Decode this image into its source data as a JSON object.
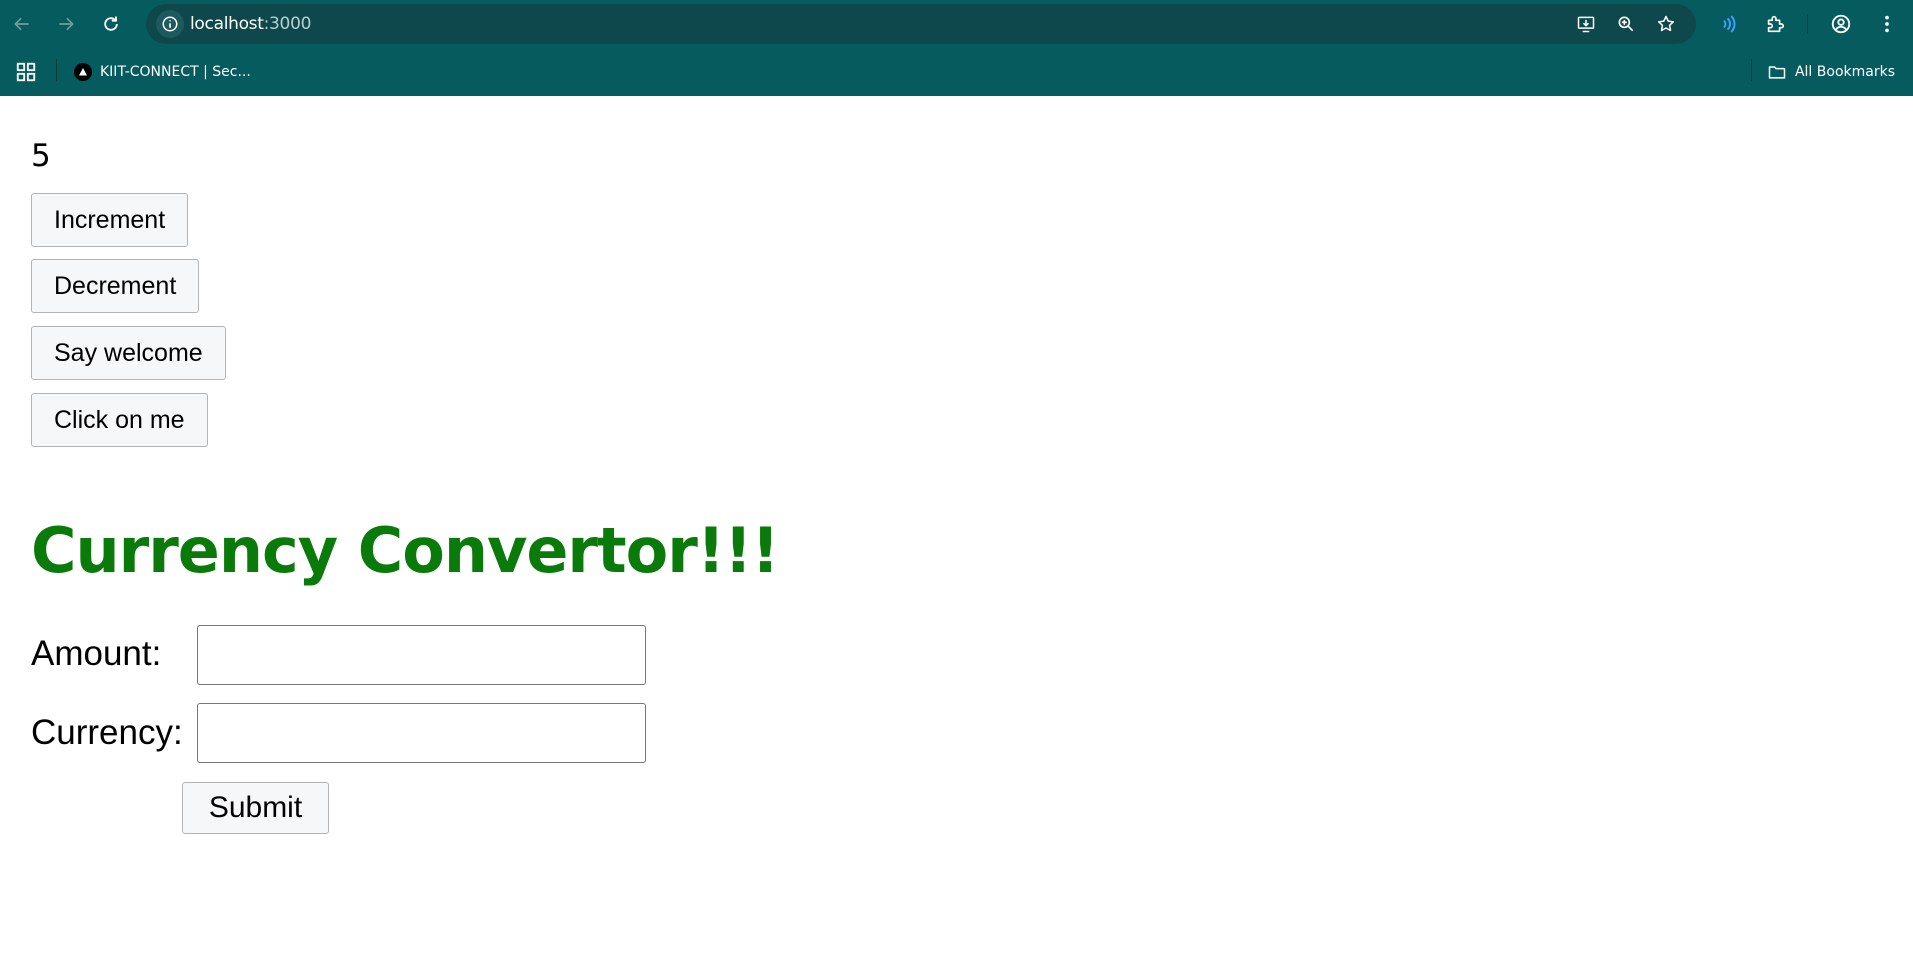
{
  "browser": {
    "url_host": "localhost",
    "url_port": ":3000",
    "bookmarks": [
      {
        "label": "KIIT-CONNECT | Sec..."
      }
    ],
    "all_bookmarks_label": "All Bookmarks",
    "toolbar_icons": [
      "back-icon",
      "forward-icon",
      "reload-icon",
      "site-info-icon",
      "install-app-icon",
      "zoom-icon",
      "bookmark-star-icon",
      "extension-active-icon",
      "extensions-icon",
      "profile-icon",
      "menu-icon"
    ]
  },
  "page": {
    "counter_value": "5",
    "buttons": {
      "increment": "Increment",
      "decrement": "Decrement",
      "say_welcome": "Say welcome",
      "click_on_me": "Click on me"
    },
    "converter": {
      "heading": "Currency Convertor!!!",
      "heading_color": "#0a7a0a",
      "amount_label": "Amount:",
      "amount_value": "",
      "currency_label": "Currency:",
      "currency_value": "",
      "submit_label": "Submit"
    }
  }
}
